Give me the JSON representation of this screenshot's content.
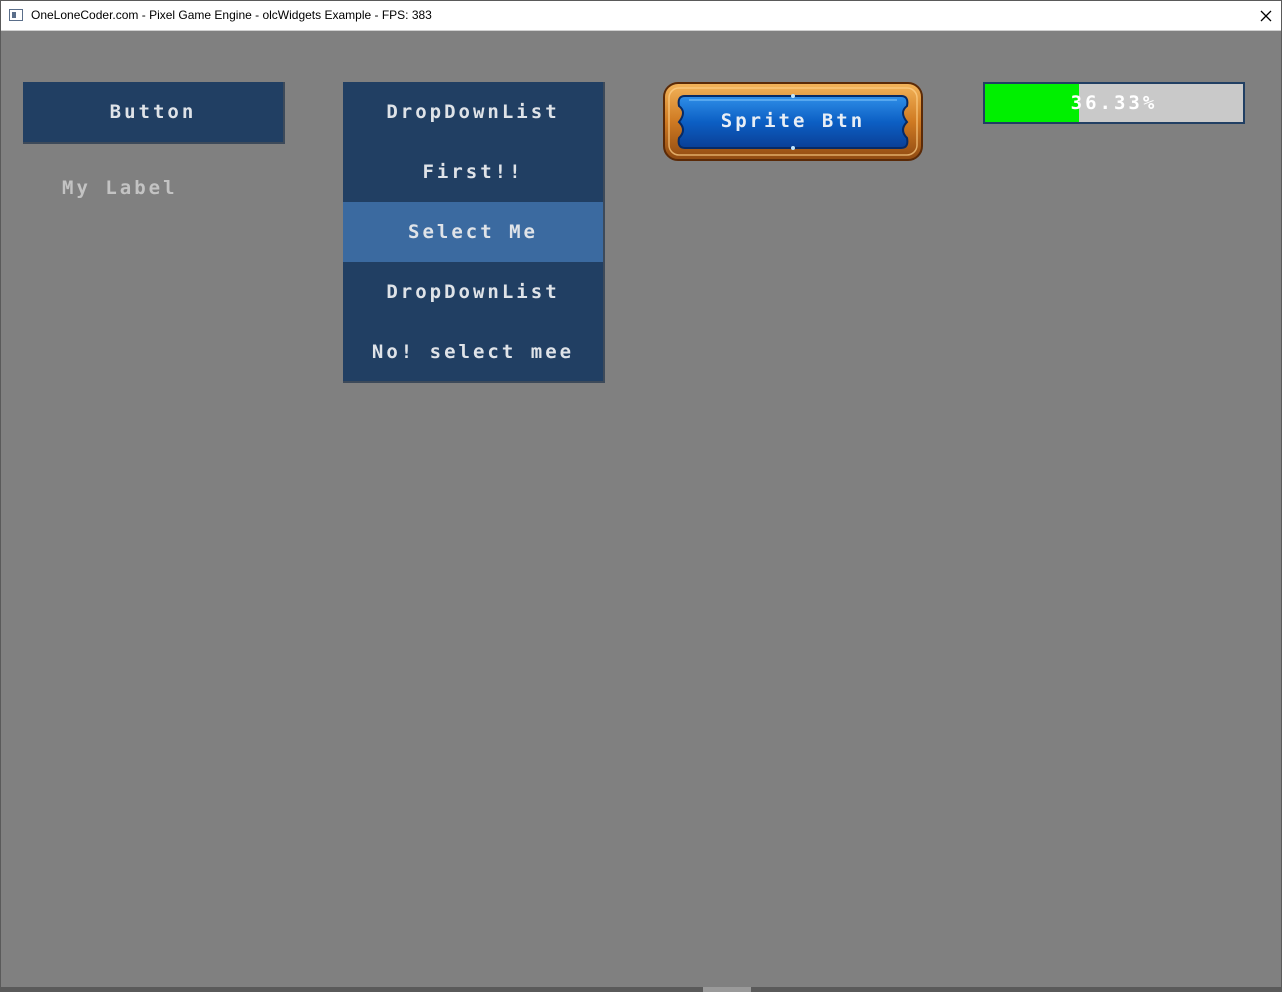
{
  "window": {
    "title": "OneLoneCoder.com - Pixel Game Engine - olcWidgets Example - FPS: 383",
    "icon": "app-window-icon",
    "close_icon": "close-icon"
  },
  "widgets": {
    "button_label": "Button",
    "label_text": "My Label",
    "dropdown_items": [
      {
        "label": "DropDownList",
        "highlighted": false
      },
      {
        "label": "First!!",
        "highlighted": false
      },
      {
        "label": "Select Me",
        "highlighted": true
      },
      {
        "label": "DropDownList",
        "highlighted": false
      },
      {
        "label": "No! select mee",
        "highlighted": false
      }
    ],
    "sprite_button_label": "Sprite Btn",
    "progress": {
      "value": 0.3633,
      "text": "36.33%"
    }
  },
  "colors": {
    "background": "#808080",
    "widget_fill": "#213f63",
    "widget_highlight": "#3b6aa0",
    "progress_fill": "#00f000",
    "progress_track": "#c9c9c9",
    "label_text": "#c3c3c3",
    "sprite_frame": "#c8741e",
    "sprite_center": "#0d63c9"
  }
}
